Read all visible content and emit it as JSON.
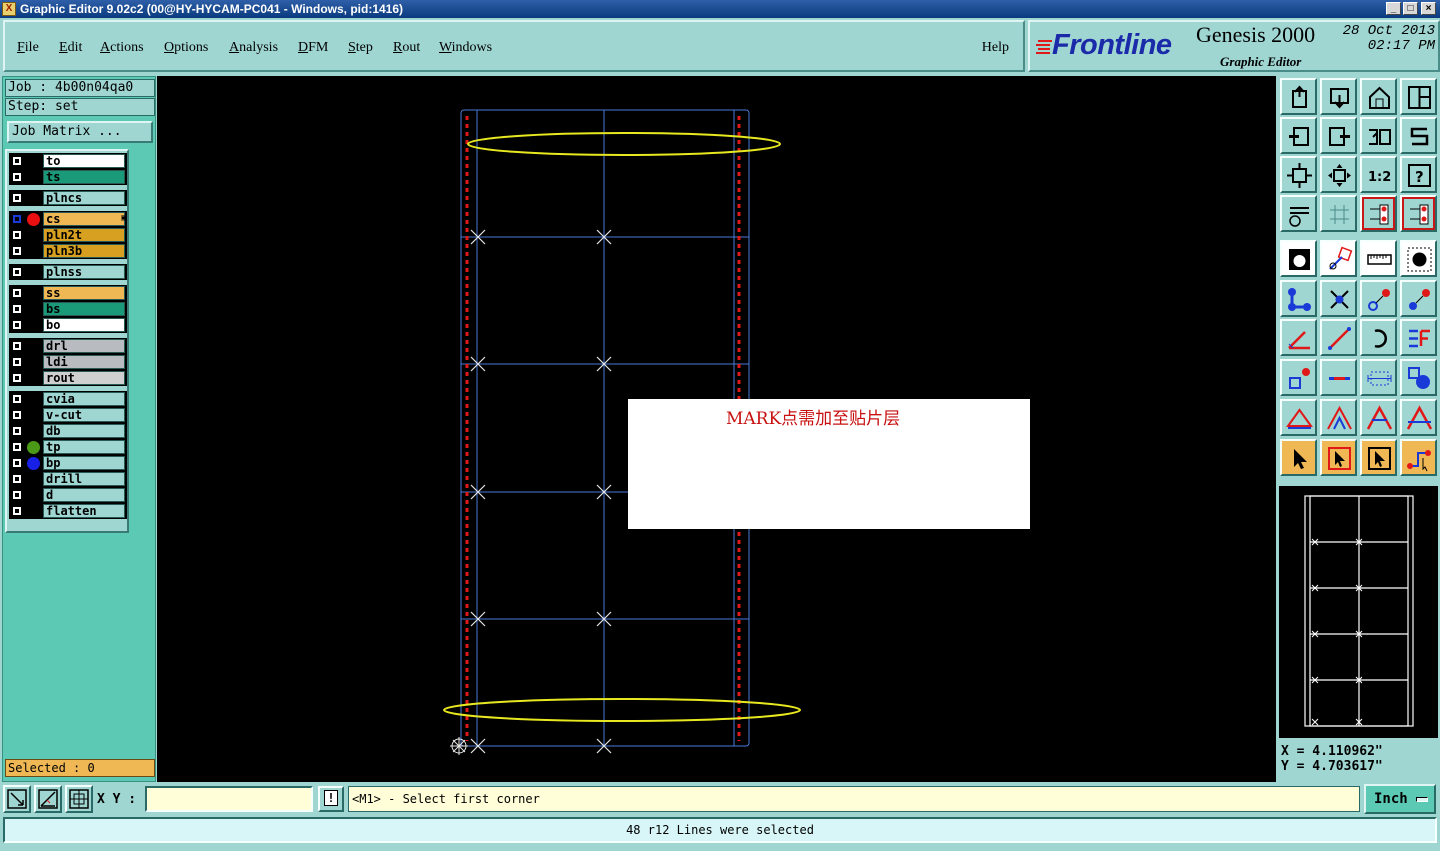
{
  "window": {
    "title": "Graphic Editor 9.02c2 (00@HY-HYCAM-PC041 - Windows, pid:1416)",
    "controls": [
      "_",
      "□",
      "×"
    ]
  },
  "menu": {
    "items": [
      "File",
      "Edit",
      "Actions",
      "Options",
      "Analysis",
      "DFM",
      "Step",
      "Rout",
      "Windows"
    ],
    "help": "Help"
  },
  "brand": {
    "logo": "Frontline",
    "product": "Genesis 2000",
    "subtitle": "Graphic Editor",
    "date": "28 Oct 2013",
    "time": "02:17 PM"
  },
  "job": {
    "job_label": "Job : 4b00n04qa0",
    "step_label": "Step: set",
    "matrix_button": "Job Matrix ..."
  },
  "layers": [
    {
      "name": "to",
      "color": "#ffffff",
      "dot": null
    },
    {
      "name": "ts",
      "color": "#1a9a78",
      "dot": null
    },
    {
      "name": "plncs",
      "color": "#9fd6d2",
      "dot": null
    },
    {
      "name": "cs",
      "color": "#f0b855",
      "dot": "#e81010",
      "active": true
    },
    {
      "name": "pln2t",
      "color": "#d8a020",
      "dot": null
    },
    {
      "name": "pln3b",
      "color": "#d8a020",
      "dot": null
    },
    {
      "name": "plnss",
      "color": "#9fd6d2",
      "dot": null
    },
    {
      "name": "ss",
      "color": "#f0b855",
      "dot": null
    },
    {
      "name": "bs",
      "color": "#1a9a78",
      "dot": null
    },
    {
      "name": "bo",
      "color": "#ffffff",
      "dot": null
    },
    {
      "name": "drl",
      "color": "#b8bcc0",
      "dot": null
    },
    {
      "name": "ldi",
      "color": "#b8bcc0",
      "dot": null
    },
    {
      "name": "rout",
      "color": "#d0d0d0",
      "dot": null
    },
    {
      "name": "cvia",
      "color": "#9fd6d2",
      "dot": null
    },
    {
      "name": "v-cut",
      "color": "#9fd6d2",
      "dot": null
    },
    {
      "name": "db",
      "color": "#9fd6d2",
      "dot": null
    },
    {
      "name": "tp",
      "color": "#9fd6d2",
      "dot": "#4a9a18"
    },
    {
      "name": "bp",
      "color": "#9fd6d2",
      "dot": "#1820e8"
    },
    {
      "name": "drill",
      "color": "#9fd6d2",
      "dot": null
    },
    {
      "name": "d",
      "color": "#9fd6d2",
      "dot": null
    },
    {
      "name": "flatten",
      "color": "#9fd6d2",
      "dot": null
    }
  ],
  "selected_label": "Selected : 0",
  "canvas": {
    "annotation": "MARK点需加至贴片层"
  },
  "toolbar_icons": [
    "open-job-icon",
    "save-icon",
    "home-icon",
    "window-icon",
    "zoom-back-icon",
    "zoom-forward-icon",
    "undo-icon",
    "redraw-icon",
    "zoom-fit-icon",
    "zoom-center-icon",
    "scale-1-2-icon",
    "help-icon",
    "settings-icon",
    "grid-icon",
    "layer-toggle-a-icon",
    "layer-toggle-b-icon",
    "snap-icon",
    "measure-icon",
    "ruler-icon",
    "pad-icon",
    "connect-icon",
    "cross-icon",
    "move-point-icon",
    "copy-point-icon",
    "angle-icon",
    "line-icon",
    "arc-icon",
    "flip-icon",
    "add-feature-icon",
    "cut-line-icon",
    "dimension-icon",
    "shapes-icon",
    "delta-a-icon",
    "delta-b-icon",
    "delta-c-icon",
    "delta-d-icon",
    "select-pointer-icon",
    "select-box-icon",
    "select-box-b-icon",
    "route-select-icon"
  ],
  "coords": {
    "x": "X = 4.110962\"",
    "y": "Y = 4.703617\""
  },
  "bottom": {
    "xy_label": "X Y :",
    "xy_value": "",
    "bang": "!",
    "prompt": "<M1> - Select first corner",
    "unit": "Inch",
    "status": "48 r12 Lines were selected"
  }
}
